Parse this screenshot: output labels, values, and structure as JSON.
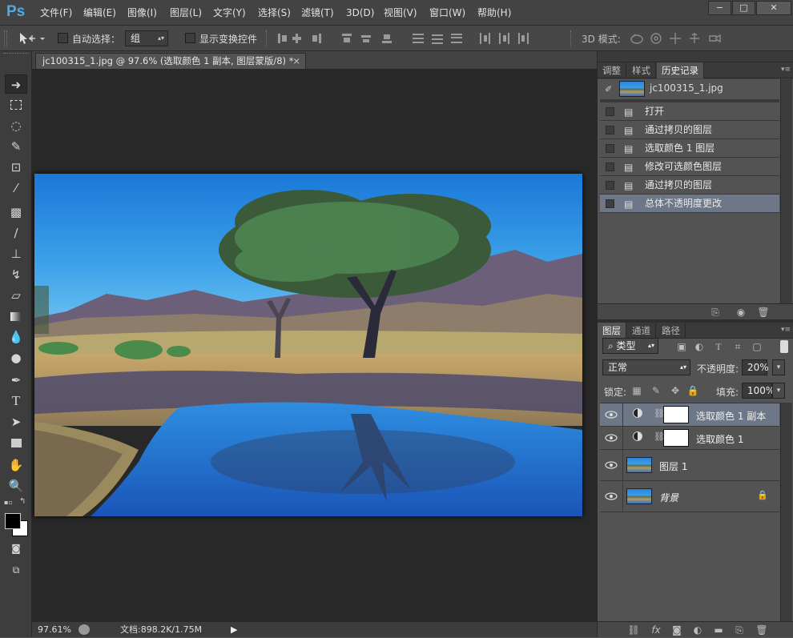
{
  "app": {
    "logo": "Ps"
  },
  "menu": [
    "文件(F)",
    "编辑(E)",
    "图像(I)",
    "图层(L)",
    "文字(Y)",
    "选择(S)",
    "滤镜(T)",
    "3D(D)",
    "视图(V)",
    "窗口(W)",
    "帮助(H)"
  ],
  "window_controls": {
    "minimize": "−",
    "restore": "□",
    "close": "✕"
  },
  "options": {
    "auto_select_label": "自动选择：",
    "auto_select_value": "组",
    "show_transform_label": "显示变换控件",
    "mode_label": "3D 模式:"
  },
  "document": {
    "tab_title": "jc100315_1.jpg @ 97.6% (选取颜色 1 副本, 图层蒙版/8) *",
    "close": "×"
  },
  "status": {
    "zoom": "97.61%",
    "doc_info": "文档:898.2K/1.75M"
  },
  "panels": {
    "top_tabs": [
      "调整",
      "样式",
      "历史记录"
    ],
    "history": {
      "snapshot_name": "jc100315_1.jpg",
      "items": [
        "打开",
        "通过拷贝的图层",
        "选取颜色 1 图层",
        "修改可选颜色图层",
        "通过拷贝的图层",
        "总体不透明度更改"
      ],
      "selected_index": 5
    },
    "layer_tabs": [
      "图层",
      "通道",
      "路径"
    ],
    "filter_kind": "类型",
    "blend_mode": "正常",
    "opacity_label": "不透明度:",
    "opacity_value": "20%",
    "lock_label": "锁定:",
    "fill_label": "填充:",
    "fill_value": "100%",
    "layers": [
      {
        "name": "选取颜色 1 副本",
        "type": "adjustment",
        "selected": true
      },
      {
        "name": "选取颜色 1",
        "type": "adjustment",
        "selected": false
      },
      {
        "name": "图层 1",
        "type": "image",
        "selected": false
      },
      {
        "name": "背景",
        "type": "background",
        "selected": false
      }
    ]
  },
  "colors": {
    "accent": "#4fa9e8",
    "selection": "#6e7787",
    "panel": "#535353"
  }
}
